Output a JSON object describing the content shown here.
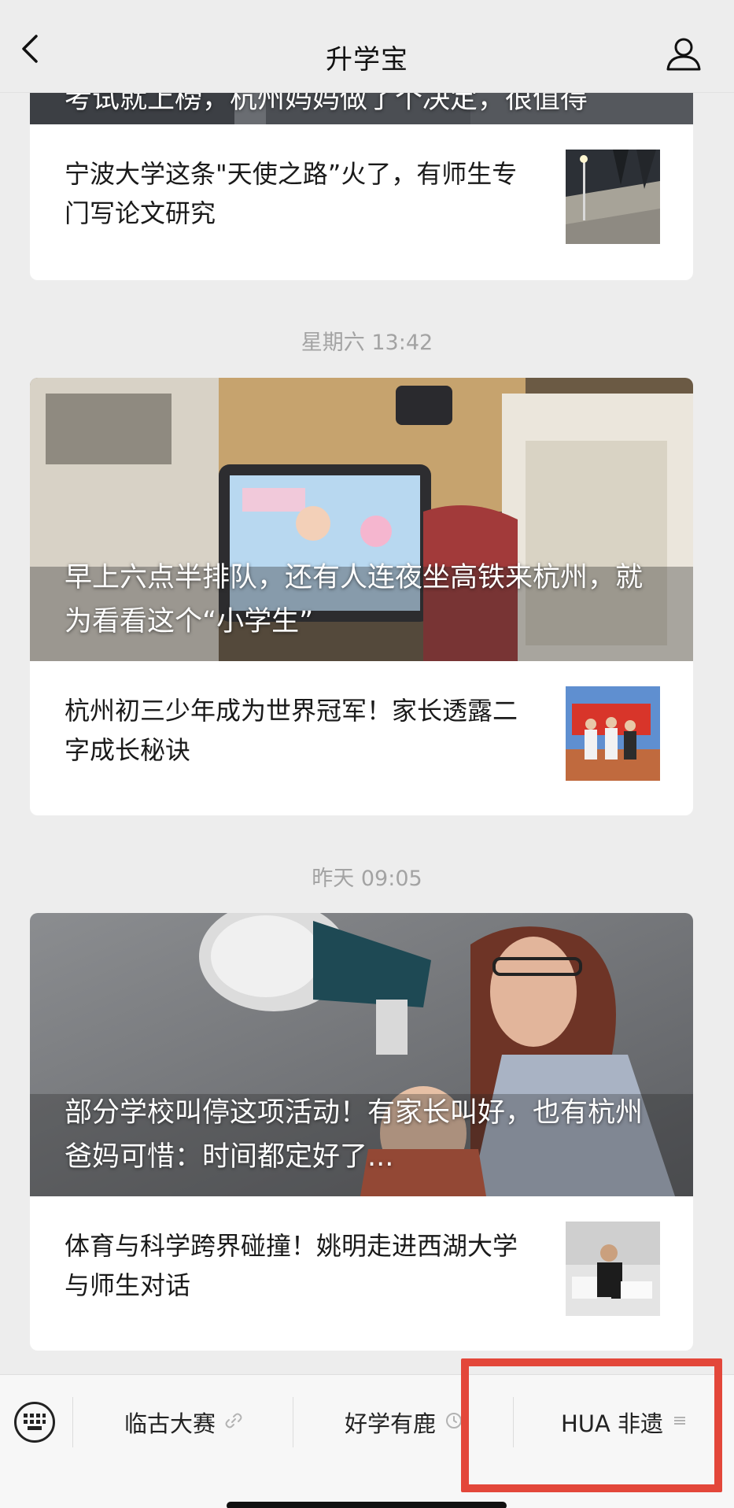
{
  "header": {
    "title": "升学宝"
  },
  "feed": {
    "partial_article": {
      "headline": "考试就上榜，杭州妈妈做了个决定，很值得"
    },
    "article_ningbo": {
      "title": "宁波大学这条\"天使之路”火了，有师生专门写论文研究"
    },
    "group_saturday": {
      "time": "星期六 13:42",
      "hero_headline": "早上六点半排队，还有人连夜坐高铁来杭州，就为看看这个“小学生”",
      "article_title": "杭州初三少年成为世界冠军！家长透露二字成长秘诀"
    },
    "group_yesterday": {
      "time": "昨天 09:05",
      "hero_headline": "部分学校叫停这项活动！有家长叫好，也有杭州爸妈可惜：时间都定好了...",
      "article_title": "体育与科学跨界碰撞！姚明走进西湖大学与师生对话"
    }
  },
  "bottom_menu": {
    "items": [
      {
        "label": "临古大赛",
        "icon": "link-icon"
      },
      {
        "label": "好学有鹿",
        "icon": "clock-icon"
      },
      {
        "label": "HUA 非遗",
        "icon": "menu-lines-icon"
      }
    ],
    "highlight_color": "#e3473a"
  }
}
